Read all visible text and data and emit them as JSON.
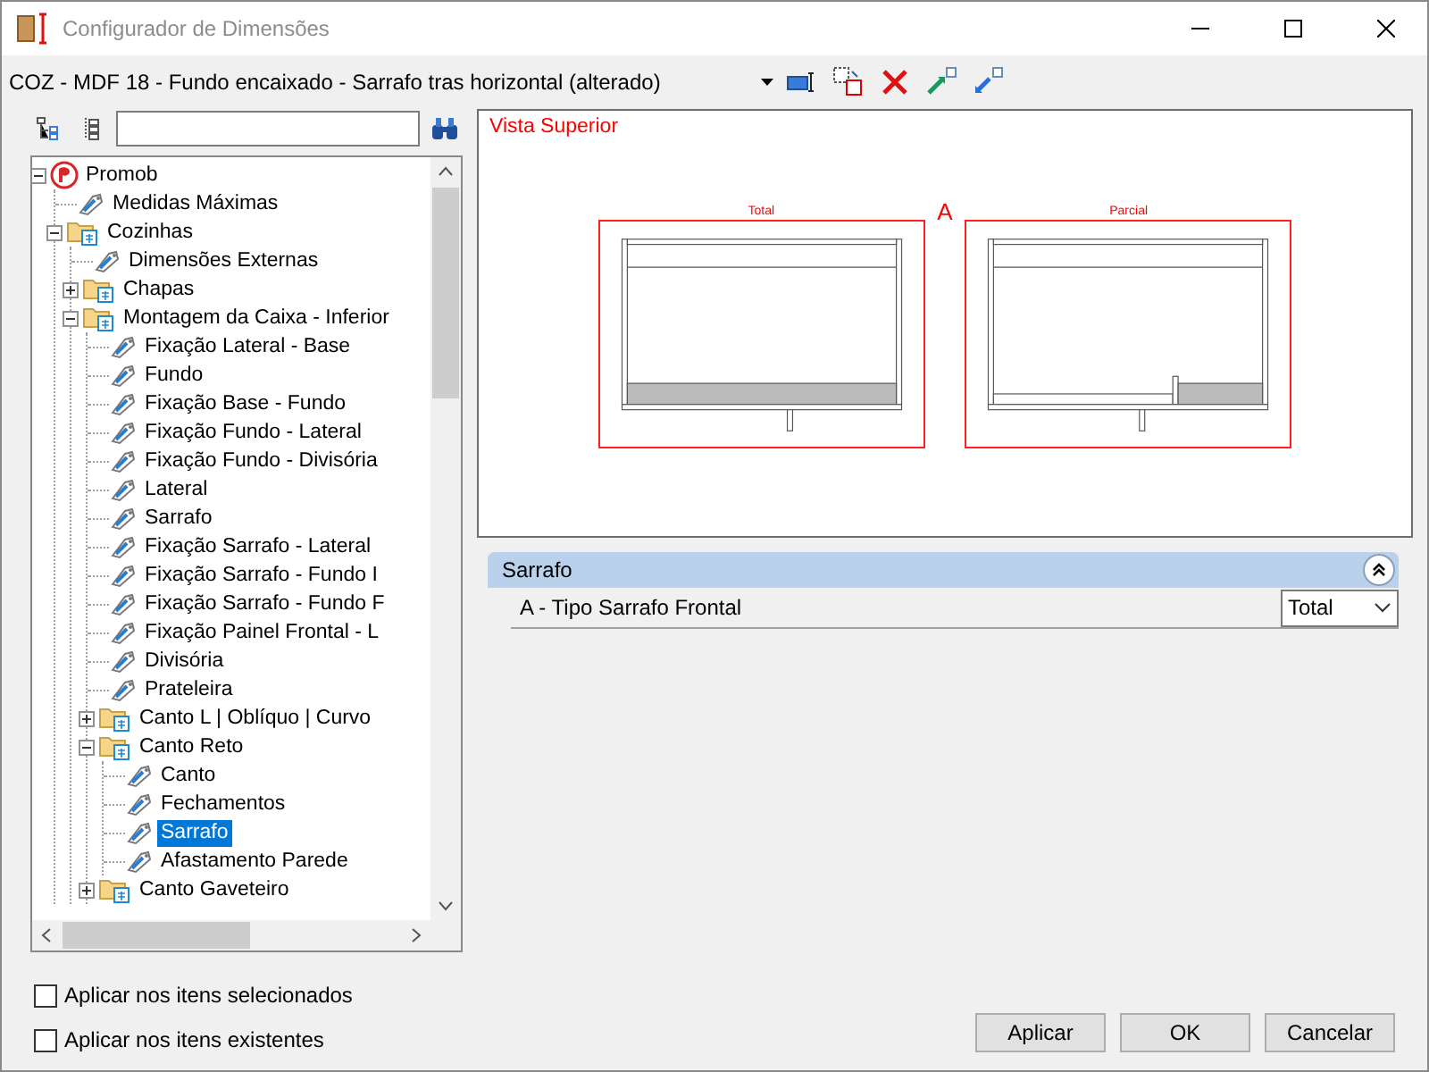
{
  "window": {
    "title": "Configurador de Dimensões"
  },
  "preset": {
    "value": "COZ - MDF 18 - Fundo encaixado - Sarrafo tras horizontal (alterado)"
  },
  "tree": {
    "items": [
      {
        "label": "Promob",
        "kind": "root",
        "expanded": true,
        "selected": false,
        "children": [
          {
            "label": "Medidas Máximas",
            "kind": "item",
            "selected": false
          },
          {
            "label": "Cozinhas",
            "kind": "folder",
            "expanded": true,
            "selected": false,
            "children": [
              {
                "label": "Dimensões Externas",
                "kind": "item",
                "selected": false
              },
              {
                "label": "Chapas",
                "kind": "folder",
                "expanded": false,
                "selected": false
              },
              {
                "label": "Montagem da Caixa - Inferior",
                "kind": "folder",
                "expanded": true,
                "selected": false,
                "children": [
                  {
                    "label": "Fixação Lateral - Base",
                    "kind": "item",
                    "selected": false
                  },
                  {
                    "label": "Fundo",
                    "kind": "item",
                    "selected": false
                  },
                  {
                    "label": "Fixação Base - Fundo",
                    "kind": "item",
                    "selected": false
                  },
                  {
                    "label": "Fixação Fundo - Lateral",
                    "kind": "item",
                    "selected": false
                  },
                  {
                    "label": "Fixação Fundo - Divisória",
                    "kind": "item",
                    "selected": false
                  },
                  {
                    "label": "Lateral",
                    "kind": "item",
                    "selected": false
                  },
                  {
                    "label": "Sarrafo",
                    "kind": "item",
                    "selected": false
                  },
                  {
                    "label": "Fixação Sarrafo - Lateral",
                    "kind": "item",
                    "selected": false
                  },
                  {
                    "label": "Fixação Sarrafo - Fundo I",
                    "kind": "item",
                    "selected": false
                  },
                  {
                    "label": "Fixação Sarrafo - Fundo F",
                    "kind": "item",
                    "selected": false
                  },
                  {
                    "label": "Fixação Painel Frontal - L",
                    "kind": "item",
                    "selected": false
                  },
                  {
                    "label": "Divisória",
                    "kind": "item",
                    "selected": false
                  },
                  {
                    "label": "Prateleira",
                    "kind": "item",
                    "selected": false
                  },
                  {
                    "label": "Canto L | Oblíquo | Curvo",
                    "kind": "folder",
                    "expanded": false,
                    "selected": false
                  },
                  {
                    "label": "Canto Reto",
                    "kind": "folder",
                    "expanded": true,
                    "selected": false,
                    "children": [
                      {
                        "label": "Canto",
                        "kind": "item",
                        "selected": false
                      },
                      {
                        "label": "Fechamentos",
                        "kind": "item",
                        "selected": false
                      },
                      {
                        "label": "Sarrafo",
                        "kind": "item",
                        "selected": true
                      },
                      {
                        "label": "Afastamento Parede",
                        "kind": "item",
                        "selected": false
                      }
                    ]
                  },
                  {
                    "label": "Canto Gaveteiro",
                    "kind": "folder",
                    "expanded": false,
                    "selected": false
                  }
                ]
              }
            ]
          }
        ]
      }
    ]
  },
  "preview": {
    "title": "Vista Superior",
    "marker": "A",
    "options": [
      {
        "label": "Total",
        "kind": "total"
      },
      {
        "label": "Parcial",
        "kind": "partial"
      }
    ]
  },
  "properties": {
    "group": {
      "title": "Sarrafo",
      "expanded": true
    },
    "rows": [
      {
        "label": "A - Tipo Sarrafo Frontal",
        "value": "Total"
      }
    ]
  },
  "options": [
    {
      "label": "Aplicar nos itens selecionados",
      "checked": false
    },
    {
      "label": "Aplicar nos itens existentes",
      "checked": false
    }
  ],
  "buttons": [
    "Aplicar",
    "OK",
    "Cancelar"
  ]
}
